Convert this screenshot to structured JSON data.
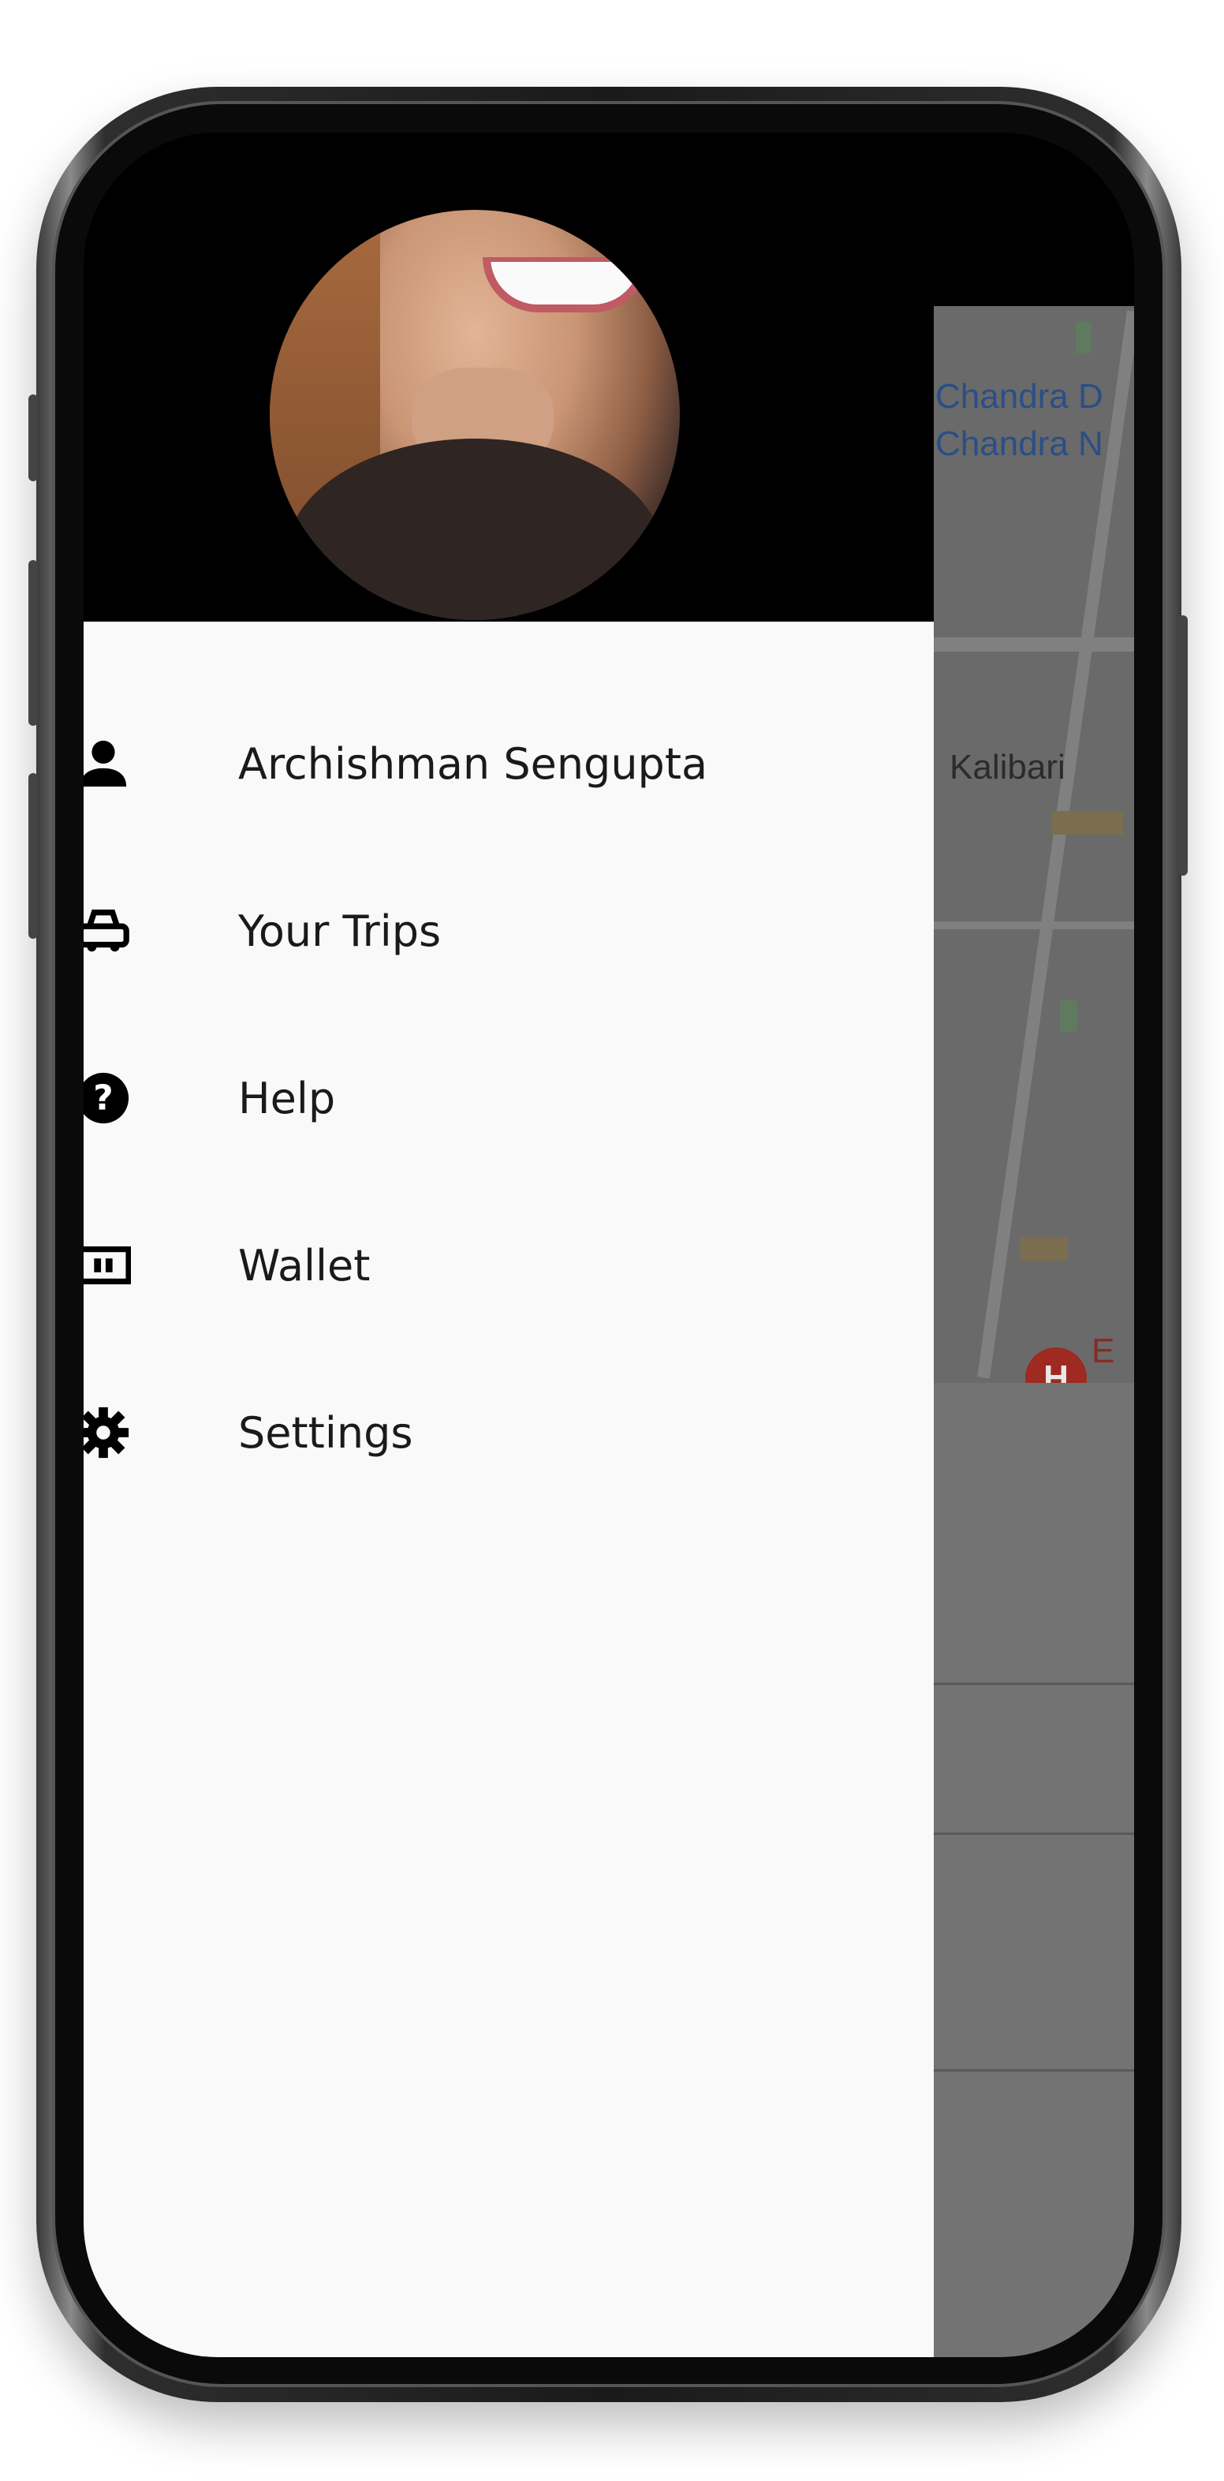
{
  "drawer": {
    "items": [
      {
        "label": "Archishman Sengupta",
        "icon": "person-icon"
      },
      {
        "label": "Your Trips",
        "icon": "car-icon"
      },
      {
        "label": "Help",
        "icon": "help-icon"
      },
      {
        "label": "Wallet",
        "icon": "wallet-icon"
      },
      {
        "label": "Settings",
        "icon": "settings-icon"
      }
    ]
  },
  "map": {
    "labels": [
      "Chandra D",
      "Chandra N",
      "Kalibari",
      "E",
      "H"
    ]
  },
  "colors": {
    "drawer_bg": "#f9f9f9",
    "header_bg": "#000000",
    "scrim": "#737373",
    "map_text": "#2a4f85",
    "pin": "#9e2a22"
  }
}
